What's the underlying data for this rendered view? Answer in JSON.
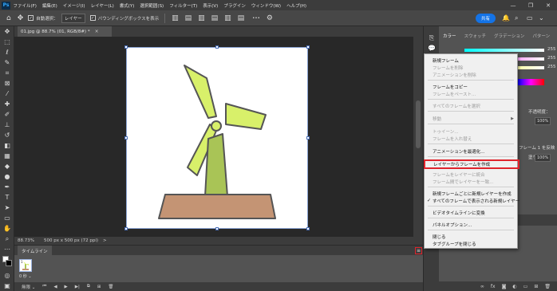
{
  "app": {
    "logo": "Ps"
  },
  "menu": [
    "ファイル(F)",
    "編集(E)",
    "イメージ(I)",
    "レイヤー(L)",
    "書式(Y)",
    "選択範囲(S)",
    "フィルター(T)",
    "表示(V)",
    "プラグイン",
    "ウィンドウ(W)",
    "ヘルプ(H)"
  ],
  "window_controls": {
    "minimize": "—",
    "restore": "❐",
    "close": "✕"
  },
  "options": {
    "auto_select_label": "自動選択：",
    "auto_select_value": "レイヤー",
    "bounding_box_label": "バウンディングボックスを表示",
    "more": "•••",
    "share": "共有"
  },
  "document": {
    "tab_title": "01.jpg @ 88.7% (01, RGB/8#) *",
    "close": "×"
  },
  "status": {
    "zoom": "88.73%",
    "size": "500 px x 500 px (72 ppi)",
    "arrow": ">"
  },
  "timeline": {
    "tab": "タイムライン",
    "menu_icon": "≡",
    "frame_number": "1",
    "frame_time": "0 秒 ⌄",
    "loop": "無限 ⌄"
  },
  "right_panel": {
    "tabs": [
      "カラー",
      "スウォッチ",
      "グラデーション",
      "パターン"
    ],
    "slider_values": [
      "255",
      "255",
      "255"
    ],
    "opacity_label": "不透明度：",
    "opacity_value": "100%",
    "frame_label": "フレーム 1 を反映",
    "fill_label": "塗り：",
    "fill_value": "100%"
  },
  "flyout": {
    "items": [
      {
        "label": "新規フレーム",
        "disabled": false
      },
      {
        "label": "フレームを削除",
        "disabled": true
      },
      {
        "label": "アニメーションを削除",
        "disabled": true
      },
      {
        "label": "フレームをコピー",
        "disabled": false
      },
      {
        "label": "フレームをペースト...",
        "disabled": true
      },
      {
        "label": "すべてのフレームを選択",
        "disabled": true
      },
      {
        "label": "移動",
        "disabled": true,
        "submenu": true
      },
      {
        "label": "トゥイーン...",
        "disabled": true
      },
      {
        "label": "フレームを入れ替え",
        "disabled": true
      },
      {
        "label": "アニメーションを最適化...",
        "disabled": false
      },
      {
        "label": "レイヤーからフレームを作成",
        "disabled": false,
        "highlight": true
      },
      {
        "label": "フレームをレイヤーに統合",
        "disabled": true
      },
      {
        "label": "フレーム間でレイヤーを一致...",
        "disabled": true
      },
      {
        "label": "新規フレームごとに新規レイヤーを作成",
        "disabled": false
      },
      {
        "label": "すべてのフレームで表示される新規レイヤー",
        "disabled": false,
        "checked": true
      },
      {
        "label": "ビデオタイムラインに変換",
        "disabled": false
      },
      {
        "label": "パネルオプション...",
        "disabled": false
      },
      {
        "label": "閉じる",
        "disabled": false
      },
      {
        "label": "タブグループを閉じる",
        "disabled": false
      }
    ]
  },
  "colors": {
    "highlight": "#e0242c",
    "accent": "#1473e6",
    "blade": "#d8f06a",
    "tower": "#a9c456",
    "ground": "#c49474"
  }
}
